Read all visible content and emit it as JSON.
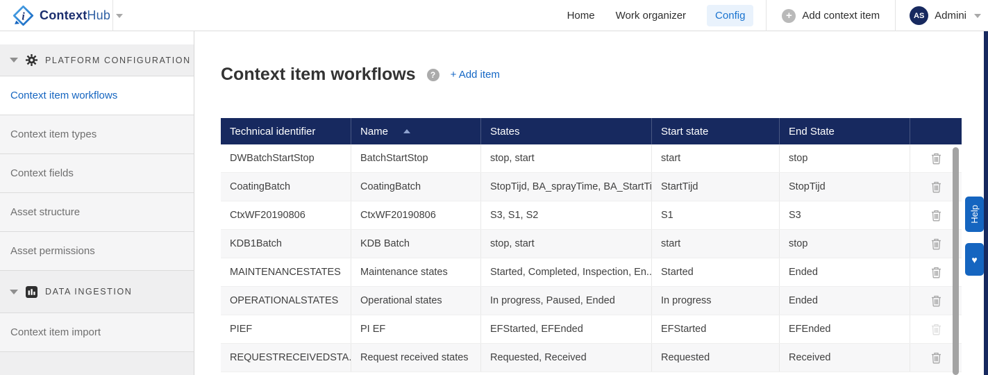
{
  "navbar": {
    "brand": {
      "bold": "Context",
      "light": "Hub"
    },
    "nav_items": [
      {
        "label": "Home",
        "active": false
      },
      {
        "label": "Work organizer",
        "active": false
      },
      {
        "label": "Config",
        "active": true
      }
    ],
    "add_icon_glyph": "+",
    "add_button_label": "Add context item",
    "user": {
      "initials": "AS",
      "name": "Admini"
    }
  },
  "sidebar": {
    "sections": [
      {
        "title": "PLATFORM CONFIGURATION",
        "icon": "gear-icon",
        "items": [
          {
            "label": "Context item workflows",
            "active": true
          },
          {
            "label": "Context item types",
            "active": false
          },
          {
            "label": "Context fields",
            "active": false
          },
          {
            "label": "Asset structure",
            "active": false
          },
          {
            "label": "Asset permissions",
            "active": false
          }
        ]
      },
      {
        "title": "DATA INGESTION",
        "icon": "bar-chart-icon",
        "items": [
          {
            "label": "Context item import",
            "active": false
          }
        ]
      }
    ]
  },
  "main": {
    "title": "Context item workflows",
    "help_badge_glyph": "?",
    "add_item_label": "+ Add item",
    "table": {
      "columns": [
        {
          "label": "Technical identifier",
          "sorted": null
        },
        {
          "label": "Name",
          "sorted": "asc"
        },
        {
          "label": "States",
          "sorted": null
        },
        {
          "label": "Start state",
          "sorted": null
        },
        {
          "label": "End State",
          "sorted": null
        },
        {
          "label": "",
          "sorted": null
        }
      ],
      "rows": [
        {
          "technical_identifier": "DWBatchStartStop",
          "name": "BatchStartStop",
          "states": "stop, start",
          "start_state": "start",
          "end_state": "stop",
          "delete_enabled": true
        },
        {
          "technical_identifier": "CoatingBatch",
          "name": "CoatingBatch",
          "states": "StopTijd, BA_sprayTime, BA_StartTi...",
          "start_state": "StartTijd",
          "end_state": "StopTijd",
          "delete_enabled": true
        },
        {
          "technical_identifier": "CtxWF20190806",
          "name": "CtxWF20190806",
          "states": "S3, S1, S2",
          "start_state": "S1",
          "end_state": "S3",
          "delete_enabled": true
        },
        {
          "technical_identifier": "KDB1Batch",
          "name": "KDB Batch",
          "states": "stop, start",
          "start_state": "start",
          "end_state": "stop",
          "delete_enabled": true
        },
        {
          "technical_identifier": "MAINTENANCESTATES",
          "name": "Maintenance states",
          "states": "Started, Completed, Inspection, En...",
          "start_state": "Started",
          "end_state": "Ended",
          "delete_enabled": true
        },
        {
          "technical_identifier": "OPERATIONALSTATES",
          "name": "Operational states",
          "states": "In progress, Paused, Ended",
          "start_state": "In progress",
          "end_state": "Ended",
          "delete_enabled": true
        },
        {
          "technical_identifier": "PIEF",
          "name": "PI EF",
          "states": "EFStarted, EFEnded",
          "start_state": "EFStarted",
          "end_state": "EFEnded",
          "delete_enabled": false
        },
        {
          "technical_identifier": "REQUESTRECEIVEDSTA...",
          "name": "Request received states",
          "states": "Requested, Received",
          "start_state": "Requested",
          "end_state": "Received",
          "delete_enabled": true
        }
      ]
    }
  },
  "right_rail": {
    "help_tab_label": "Help",
    "favorite_icon_glyph": "♥"
  },
  "colors": {
    "table_header_navy": "#17295F",
    "accent_blue": "#1467C5",
    "active_nav_blue": "#1973D0",
    "config_highlight_bg": "#E9F2FC",
    "help_tab_blue": "#1565C0",
    "avatar_navy": "#17295F"
  }
}
